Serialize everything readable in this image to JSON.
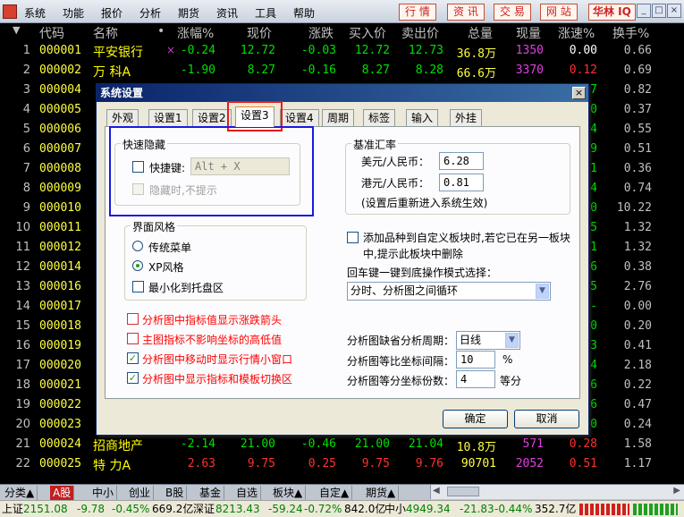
{
  "menubar": {
    "items": [
      "系统",
      "功能",
      "报价",
      "分析",
      "期货",
      "资讯",
      "工具",
      "帮助"
    ],
    "nav": [
      "行 情",
      "资 讯",
      "交 易",
      "网 站"
    ],
    "iq": "华林 IQ",
    "win": [
      "_",
      "□",
      "×"
    ]
  },
  "quote": {
    "headers": [
      "代码",
      "名称",
      "•",
      "涨幅%",
      "现价",
      "涨跌",
      "买入价",
      "卖出价",
      "总量",
      "现量",
      "涨速%",
      "换手%"
    ],
    "rows": [
      {
        "idx": "1",
        "code": "000001",
        "name": "平安银行",
        "mark": "×",
        "chg_pct": "-0.24",
        "price": "12.72",
        "chg": "-0.03",
        "bid": "12.72",
        "ask": "12.73",
        "vol": "36.8万",
        "cur": "1350",
        "spd": "0.00",
        "turn": "0.66"
      },
      {
        "idx": "2",
        "code": "000002",
        "name": "万  科A",
        "mark": "",
        "chg_pct": "-1.90",
        "price": "8.27",
        "chg": "-0.16",
        "bid": "8.27",
        "ask": "8.28",
        "vol": "66.6万",
        "cur": "3370",
        "spd": "0.12",
        "turn": "0.69"
      },
      {
        "idx": "3",
        "code": "000004",
        "name": "",
        "mark": "",
        "chg_pct": "",
        "price": "",
        "chg": "",
        "bid": "",
        "ask": "",
        "vol": "",
        "cur": "",
        "spd": "7",
        "turn": "0.82"
      },
      {
        "idx": "4",
        "code": "000005",
        "name": "",
        "mark": "",
        "chg_pct": "",
        "price": "",
        "chg": "",
        "bid": "",
        "ask": "",
        "vol": "",
        "cur": "",
        "spd": "0",
        "turn": "0.37"
      },
      {
        "idx": "5",
        "code": "000006",
        "name": "",
        "mark": "",
        "chg_pct": "",
        "price": "",
        "chg": "",
        "bid": "",
        "ask": "",
        "vol": "",
        "cur": "",
        "spd": "4",
        "turn": "0.55"
      },
      {
        "idx": "6",
        "code": "000007",
        "name": "",
        "mark": "",
        "chg_pct": "",
        "price": "",
        "chg": "",
        "bid": "",
        "ask": "",
        "vol": "",
        "cur": "",
        "spd": "9",
        "turn": "0.51"
      },
      {
        "idx": "7",
        "code": "000008",
        "name": "",
        "mark": "",
        "chg_pct": "",
        "price": "",
        "chg": "",
        "bid": "",
        "ask": "",
        "vol": "",
        "cur": "",
        "spd": "1",
        "turn": "0.36"
      },
      {
        "idx": "8",
        "code": "000009",
        "name": "",
        "mark": "",
        "chg_pct": "",
        "price": "",
        "chg": "",
        "bid": "",
        "ask": "",
        "vol": "",
        "cur": "",
        "spd": "4",
        "turn": "0.74"
      },
      {
        "idx": "9",
        "code": "000010",
        "name": "",
        "mark": "",
        "chg_pct": "",
        "price": "",
        "chg": "",
        "bid": "",
        "ask": "",
        "vol": "",
        "cur": "",
        "spd": "0",
        "turn": "10.22"
      },
      {
        "idx": "10",
        "code": "000011",
        "name": "",
        "mark": "",
        "chg_pct": "",
        "price": "",
        "chg": "",
        "bid": "",
        "ask": "",
        "vol": "",
        "cur": "",
        "spd": "5",
        "turn": "1.32"
      },
      {
        "idx": "11",
        "code": "000012",
        "name": "",
        "mark": "",
        "chg_pct": "",
        "price": "",
        "chg": "",
        "bid": "",
        "ask": "",
        "vol": "",
        "cur": "",
        "spd": "1",
        "turn": "1.32"
      },
      {
        "idx": "12",
        "code": "000014",
        "name": "",
        "mark": "",
        "chg_pct": "",
        "price": "",
        "chg": "",
        "bid": "",
        "ask": "",
        "vol": "",
        "cur": "",
        "spd": "6",
        "turn": "0.38"
      },
      {
        "idx": "13",
        "code": "000016",
        "name": "",
        "mark": "",
        "chg_pct": "",
        "price": "",
        "chg": "",
        "bid": "",
        "ask": "",
        "vol": "",
        "cur": "",
        "spd": "5",
        "turn": "2.76"
      },
      {
        "idx": "14",
        "code": "000017",
        "name": "",
        "mark": "",
        "chg_pct": "",
        "price": "",
        "chg": "",
        "bid": "",
        "ask": "",
        "vol": "",
        "cur": "",
        "spd": "-",
        "turn": "0.00"
      },
      {
        "idx": "15",
        "code": "000018",
        "name": "",
        "mark": "",
        "chg_pct": "",
        "price": "",
        "chg": "",
        "bid": "",
        "ask": "",
        "vol": "",
        "cur": "",
        "spd": "0",
        "turn": "0.20"
      },
      {
        "idx": "16",
        "code": "000019",
        "name": "",
        "mark": "",
        "chg_pct": "",
        "price": "",
        "chg": "",
        "bid": "",
        "ask": "",
        "vol": "",
        "cur": "",
        "spd": "3",
        "turn": "0.41"
      },
      {
        "idx": "17",
        "code": "000020",
        "name": "",
        "mark": "",
        "chg_pct": "",
        "price": "",
        "chg": "",
        "bid": "",
        "ask": "",
        "vol": "",
        "cur": "",
        "spd": "4",
        "turn": "2.18"
      },
      {
        "idx": "18",
        "code": "000021",
        "name": "",
        "mark": "",
        "chg_pct": "",
        "price": "",
        "chg": "",
        "bid": "",
        "ask": "",
        "vol": "",
        "cur": "",
        "spd": "6",
        "turn": "0.22"
      },
      {
        "idx": "19",
        "code": "000022",
        "name": "",
        "mark": "",
        "chg_pct": "",
        "price": "",
        "chg": "",
        "bid": "",
        "ask": "",
        "vol": "",
        "cur": "",
        "spd": "6",
        "turn": "0.47"
      },
      {
        "idx": "20",
        "code": "000023",
        "name": "",
        "mark": "",
        "chg_pct": "",
        "price": "",
        "chg": "",
        "bid": "",
        "ask": "",
        "vol": "",
        "cur": "",
        "spd": "0",
        "turn": "0.24"
      },
      {
        "idx": "21",
        "code": "000024",
        "name": "招商地产",
        "mark": "",
        "chg_pct": "-2.14",
        "price": "21.00",
        "chg": "-0.46",
        "bid": "21.00",
        "ask": "21.04",
        "vol": "10.8万",
        "cur": "571",
        "spd": "0.28",
        "turn": "1.58"
      },
      {
        "idx": "22",
        "code": "000025",
        "name": "特  力A",
        "mark": "",
        "chg_pct": "2.63",
        "price": "9.75",
        "chg": "0.25",
        "bid": "9.75",
        "ask": "9.76",
        "vol": "90701",
        "cur": "2052",
        "spd": "0.51",
        "turn": "1.17"
      }
    ]
  },
  "dialog": {
    "title": "系统设置",
    "close": "×",
    "tabs": [
      "外观",
      "设置1",
      "设置2",
      "设置3",
      "设置4",
      "周期",
      "标签",
      "输入",
      "外挂"
    ],
    "hotkey_group": {
      "title": "快速隐藏",
      "hotkey_label": "快捷键:",
      "hotkey_value": "Alt + X",
      "hide_no_prompt": "隐藏时,不提示"
    },
    "ui_group": {
      "title": "界面风格",
      "traditional": "传统菜单",
      "xp": "XP风格",
      "minimize_tray": "最小化到托盘区"
    },
    "rate_group": {
      "title": "基准汇率",
      "usd_label": "美元/人民币：",
      "usd_value": "6.28",
      "hkd_label": "港元/人民币：",
      "hkd_value": "0.81",
      "note": "(设置后重新进入系统生效)"
    },
    "add_block": "添加品种到自定义板块时,若它已在另一板块中,提示此板块中删除",
    "enter_label": "回车键一键到底操作模式选择：",
    "enter_value": "分时、分析图之间循环",
    "opts": [
      "分析图中指标值显示涨跌箭头",
      "主图指标不影响坐标的高低值",
      "分析图中移动时显示行情小窗口",
      "分析图中显示指标和模板切换区"
    ],
    "period_label": "分析图缺省分析周期：",
    "period_value": "日线",
    "ratio_label": "分析图等比坐标间隔：",
    "ratio_value": "10",
    "ratio_unit": "%",
    "split_label": "分析图等分坐标份数：",
    "split_value": "4",
    "split_unit": "等分",
    "ok": "确定",
    "cancel": "取消"
  },
  "sectbar": {
    "tabs": [
      "分类▲",
      "A股",
      "中小",
      "创业",
      "B股",
      "基金",
      "自选",
      "板块▲",
      "自定▲",
      "期货▲"
    ]
  },
  "status": {
    "sh": "上证",
    "sh_v": "2151.08",
    "sh_c": "-9.78",
    "sh_p": "-0.45%",
    "sh_a": "669.2亿",
    "sz": "深证",
    "sz_v": "8213.43",
    "sz_c": "-59.24",
    "sz_p": "-0.72%",
    "sz_a": "842.0亿",
    "zx": "中小",
    "zx_v": "4949.34",
    "zx_c": "-21.83",
    "zx_p": "-0.44%",
    "zx_a": "352.7亿"
  },
  "colors": {
    "up": "#ff3030",
    "down": "#00e000",
    "highlight_red": "#e81c1c",
    "highlight_blue": "#1a1ae0"
  }
}
